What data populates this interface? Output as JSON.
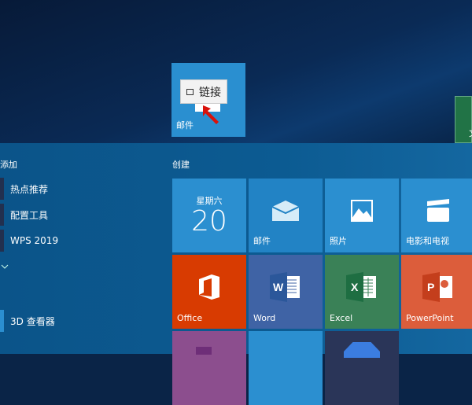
{
  "drag_tile": {
    "label": "邮件",
    "tooltip": "链接",
    "tooltip_icon": "link-icon"
  },
  "partial_tile": {
    "label": "文",
    "color": "#217346"
  },
  "left_list": {
    "header": "添加",
    "items": [
      {
        "label": "热点推荐"
      },
      {
        "label": "配置工具"
      },
      {
        "label": "WPS 2019"
      }
    ],
    "expand_icon": "chevron-down-icon",
    "app": "3D 查看器"
  },
  "group": {
    "title": "创建"
  },
  "tiles": [
    {
      "label": "",
      "day": "星期六",
      "date": "20",
      "color": "#2b8fd0"
    },
    {
      "label": "邮件",
      "color": "#2283c5"
    },
    {
      "label": "照片",
      "color": "#2b8fd0"
    },
    {
      "label": "电影和电视",
      "color": "#2b8fd0"
    },
    {
      "label": "Office",
      "color": "#d83b01"
    },
    {
      "label": "Word",
      "color": "#3f63a5"
    },
    {
      "label": "Excel",
      "color": "#3a8157"
    },
    {
      "label": "PowerPoint",
      "color": "#dc5d3b"
    }
  ]
}
